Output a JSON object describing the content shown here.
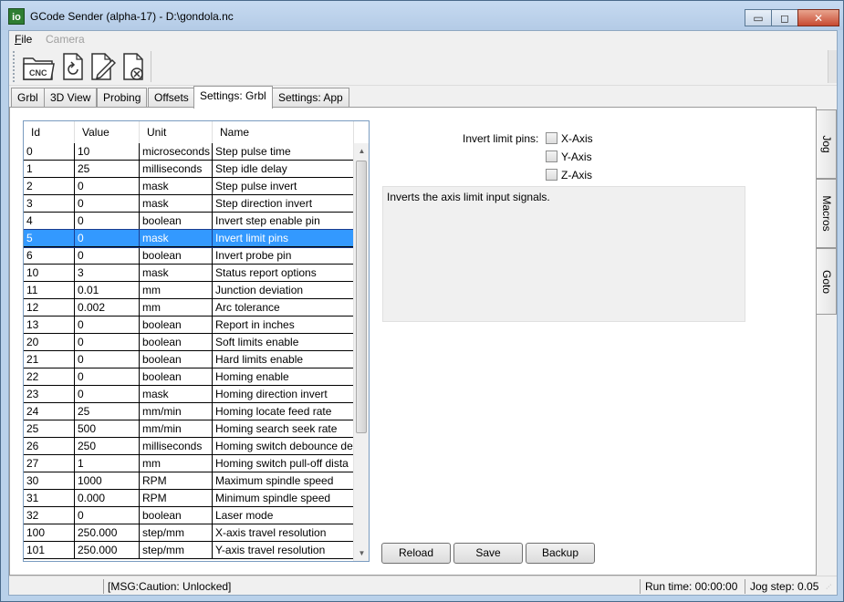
{
  "window": {
    "title": "GCode Sender (alpha-17) - D:\\gondola.nc",
    "icon_text": "io",
    "minimize": "▭",
    "maximize": "◻",
    "close": "✕"
  },
  "menu": {
    "file": "File",
    "camera": "Camera"
  },
  "toolbar": {
    "icons": [
      "cnc-open-icon",
      "reload-icon",
      "edit-icon",
      "close-file-icon"
    ],
    "cnc_label": "CNC"
  },
  "tabs": [
    "Grbl",
    "3D View",
    "Probing",
    "Offsets",
    "Settings: Grbl",
    "Settings: App"
  ],
  "active_tab": "Settings: Grbl",
  "grid": {
    "headers": [
      "Id",
      "Value",
      "Unit",
      "Name"
    ],
    "selected_index": 5,
    "rows": [
      [
        "0",
        "10",
        "microseconds",
        "Step pulse time"
      ],
      [
        "1",
        "25",
        "milliseconds",
        "Step idle delay"
      ],
      [
        "2",
        "0",
        "mask",
        "Step pulse invert"
      ],
      [
        "3",
        "0",
        "mask",
        "Step direction invert"
      ],
      [
        "4",
        "0",
        "boolean",
        "Invert step enable pin"
      ],
      [
        "5",
        "0",
        "mask",
        "Invert limit pins"
      ],
      [
        "6",
        "0",
        "boolean",
        "Invert probe pin"
      ],
      [
        "10",
        "3",
        "mask",
        "Status report options"
      ],
      [
        "11",
        "0.01",
        "mm",
        "Junction deviation"
      ],
      [
        "12",
        "0.002",
        "mm",
        "Arc tolerance"
      ],
      [
        "13",
        "0",
        "boolean",
        "Report in inches"
      ],
      [
        "20",
        "0",
        "boolean",
        "Soft limits enable"
      ],
      [
        "21",
        "0",
        "boolean",
        "Hard limits enable"
      ],
      [
        "22",
        "0",
        "boolean",
        "Homing enable"
      ],
      [
        "23",
        "0",
        "mask",
        "Homing direction invert"
      ],
      [
        "24",
        "25",
        "mm/min",
        "Homing locate feed rate"
      ],
      [
        "25",
        "500",
        "mm/min",
        "Homing search seek rate"
      ],
      [
        "26",
        "250",
        "milliseconds",
        "Homing switch debounce de"
      ],
      [
        "27",
        "1",
        "mm",
        "Homing switch pull-off dista"
      ],
      [
        "30",
        "1000",
        "RPM",
        "Maximum spindle speed"
      ],
      [
        "31",
        "0.000",
        "RPM",
        "Minimum spindle speed"
      ],
      [
        "32",
        "0",
        "boolean",
        "Laser mode"
      ],
      [
        "100",
        "250.000",
        "step/mm",
        "X-axis travel resolution"
      ],
      [
        "101",
        "250.000",
        "step/mm",
        "Y-axis travel resolution"
      ]
    ]
  },
  "detail": {
    "invert_label": "Invert limit pins:",
    "axes": [
      "X-Axis",
      "Y-Axis",
      "Z-Axis"
    ],
    "description": "Inverts the axis limit input signals."
  },
  "buttons": {
    "reload": "Reload",
    "save": "Save",
    "backup": "Backup"
  },
  "side_tabs": [
    "Jog",
    "Macros",
    "Goto"
  ],
  "status": {
    "message": "[MSG:Caution: Unlocked]",
    "run_time": "Run time:  00:00:00",
    "jog_step": "Jog step:  0.05"
  }
}
